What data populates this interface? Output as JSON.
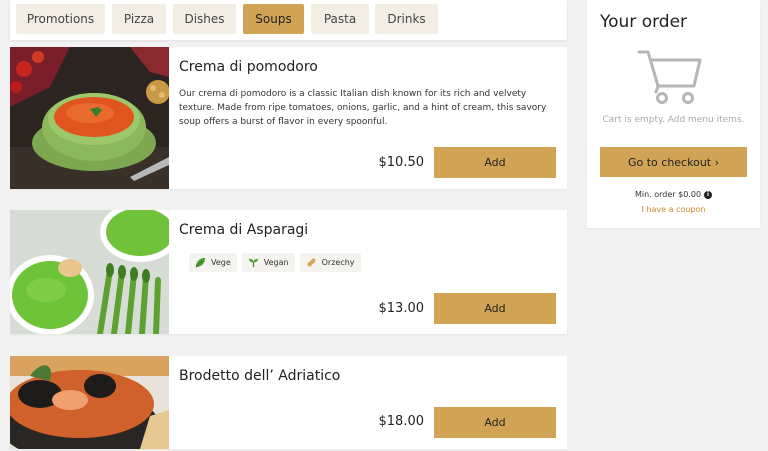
{
  "categories": [
    {
      "label": "Promotions",
      "active": false
    },
    {
      "label": "Pizza",
      "active": false
    },
    {
      "label": "Dishes",
      "active": false
    },
    {
      "label": "Soups",
      "active": true
    },
    {
      "label": "Pasta",
      "active": false
    },
    {
      "label": "Drinks",
      "active": false
    }
  ],
  "items": [
    {
      "title": "Crema di pomodoro",
      "description": "Our crema di pomodoro is a classic Italian dish known for its rich and velvety texture. Made from ripe tomatoes, onions, garlic, and a hint of cream, this savory soup offers a burst of flavor in every spoonful.",
      "price": "$10.50",
      "add_label": "Add"
    },
    {
      "title": "Crema di Asparagi",
      "tags": [
        {
          "label": "Vege",
          "icon": "leaf-icon"
        },
        {
          "label": "Vegan",
          "icon": "sprout-icon"
        },
        {
          "label": "Orzechy",
          "icon": "peanut-icon"
        }
      ],
      "price": "$13.00",
      "add_label": "Add"
    },
    {
      "title": "Brodetto dell’ Adriatico",
      "price": "$18.00",
      "add_label": "Add"
    }
  ],
  "order": {
    "title": "Your order",
    "empty_text": "Cart is empty. Add menu items.",
    "checkout_label": "Go to checkout ›",
    "min_order": "Min. order $0.00",
    "coupon_label": "I have a coupon"
  },
  "colors": {
    "accent": "#d1a455",
    "tab_bg": "#f3eee3",
    "coupon_link": "#c98a2a"
  }
}
